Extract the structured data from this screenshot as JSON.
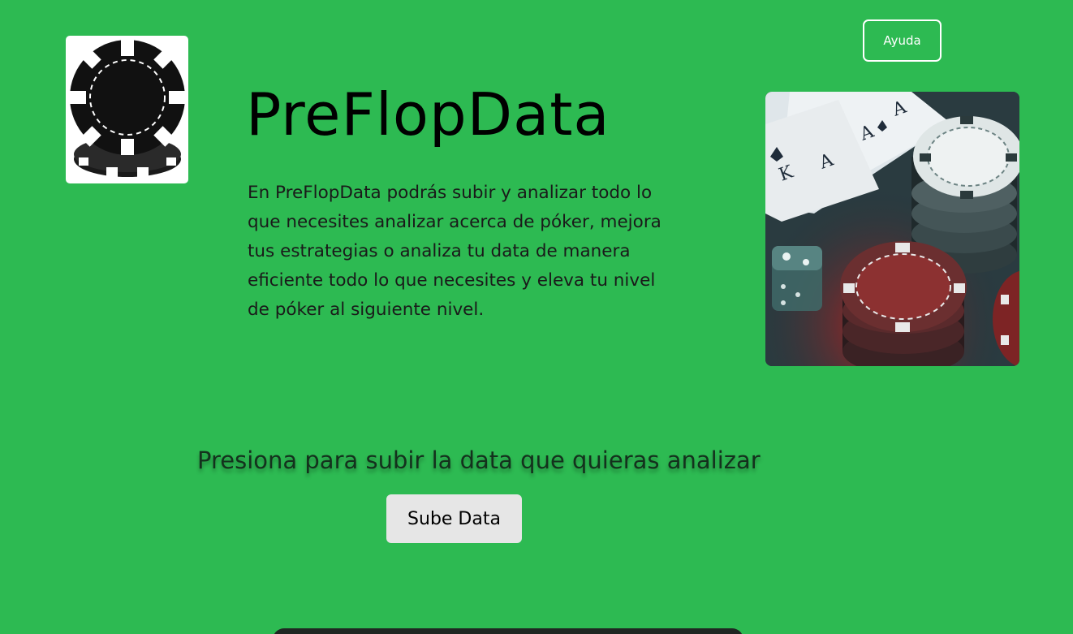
{
  "header": {
    "help_label": "Ayuda"
  },
  "logo": {
    "icon": "poker-chip-icon",
    "colors": {
      "chip": "#111111",
      "stripe": "#ffffff"
    }
  },
  "hero": {
    "title": "PreFlopData",
    "description": "En PreFlopData podrás subir y analizar todo lo que necesites analizar acerca de póker, mejora tus estrategias o analiza tu data de manera eficiente todo lo que necesites y eleva tu nivel de póker al siguiente nivel.",
    "image": "poker-cards-chips-dice-image"
  },
  "upload": {
    "prompt": "Presiona para subir la data que quieras analizar",
    "button_label": "Sube Data"
  },
  "theme": {
    "background": "#2dba52",
    "button_bg": "#e6e6e6",
    "text": "#000000"
  }
}
